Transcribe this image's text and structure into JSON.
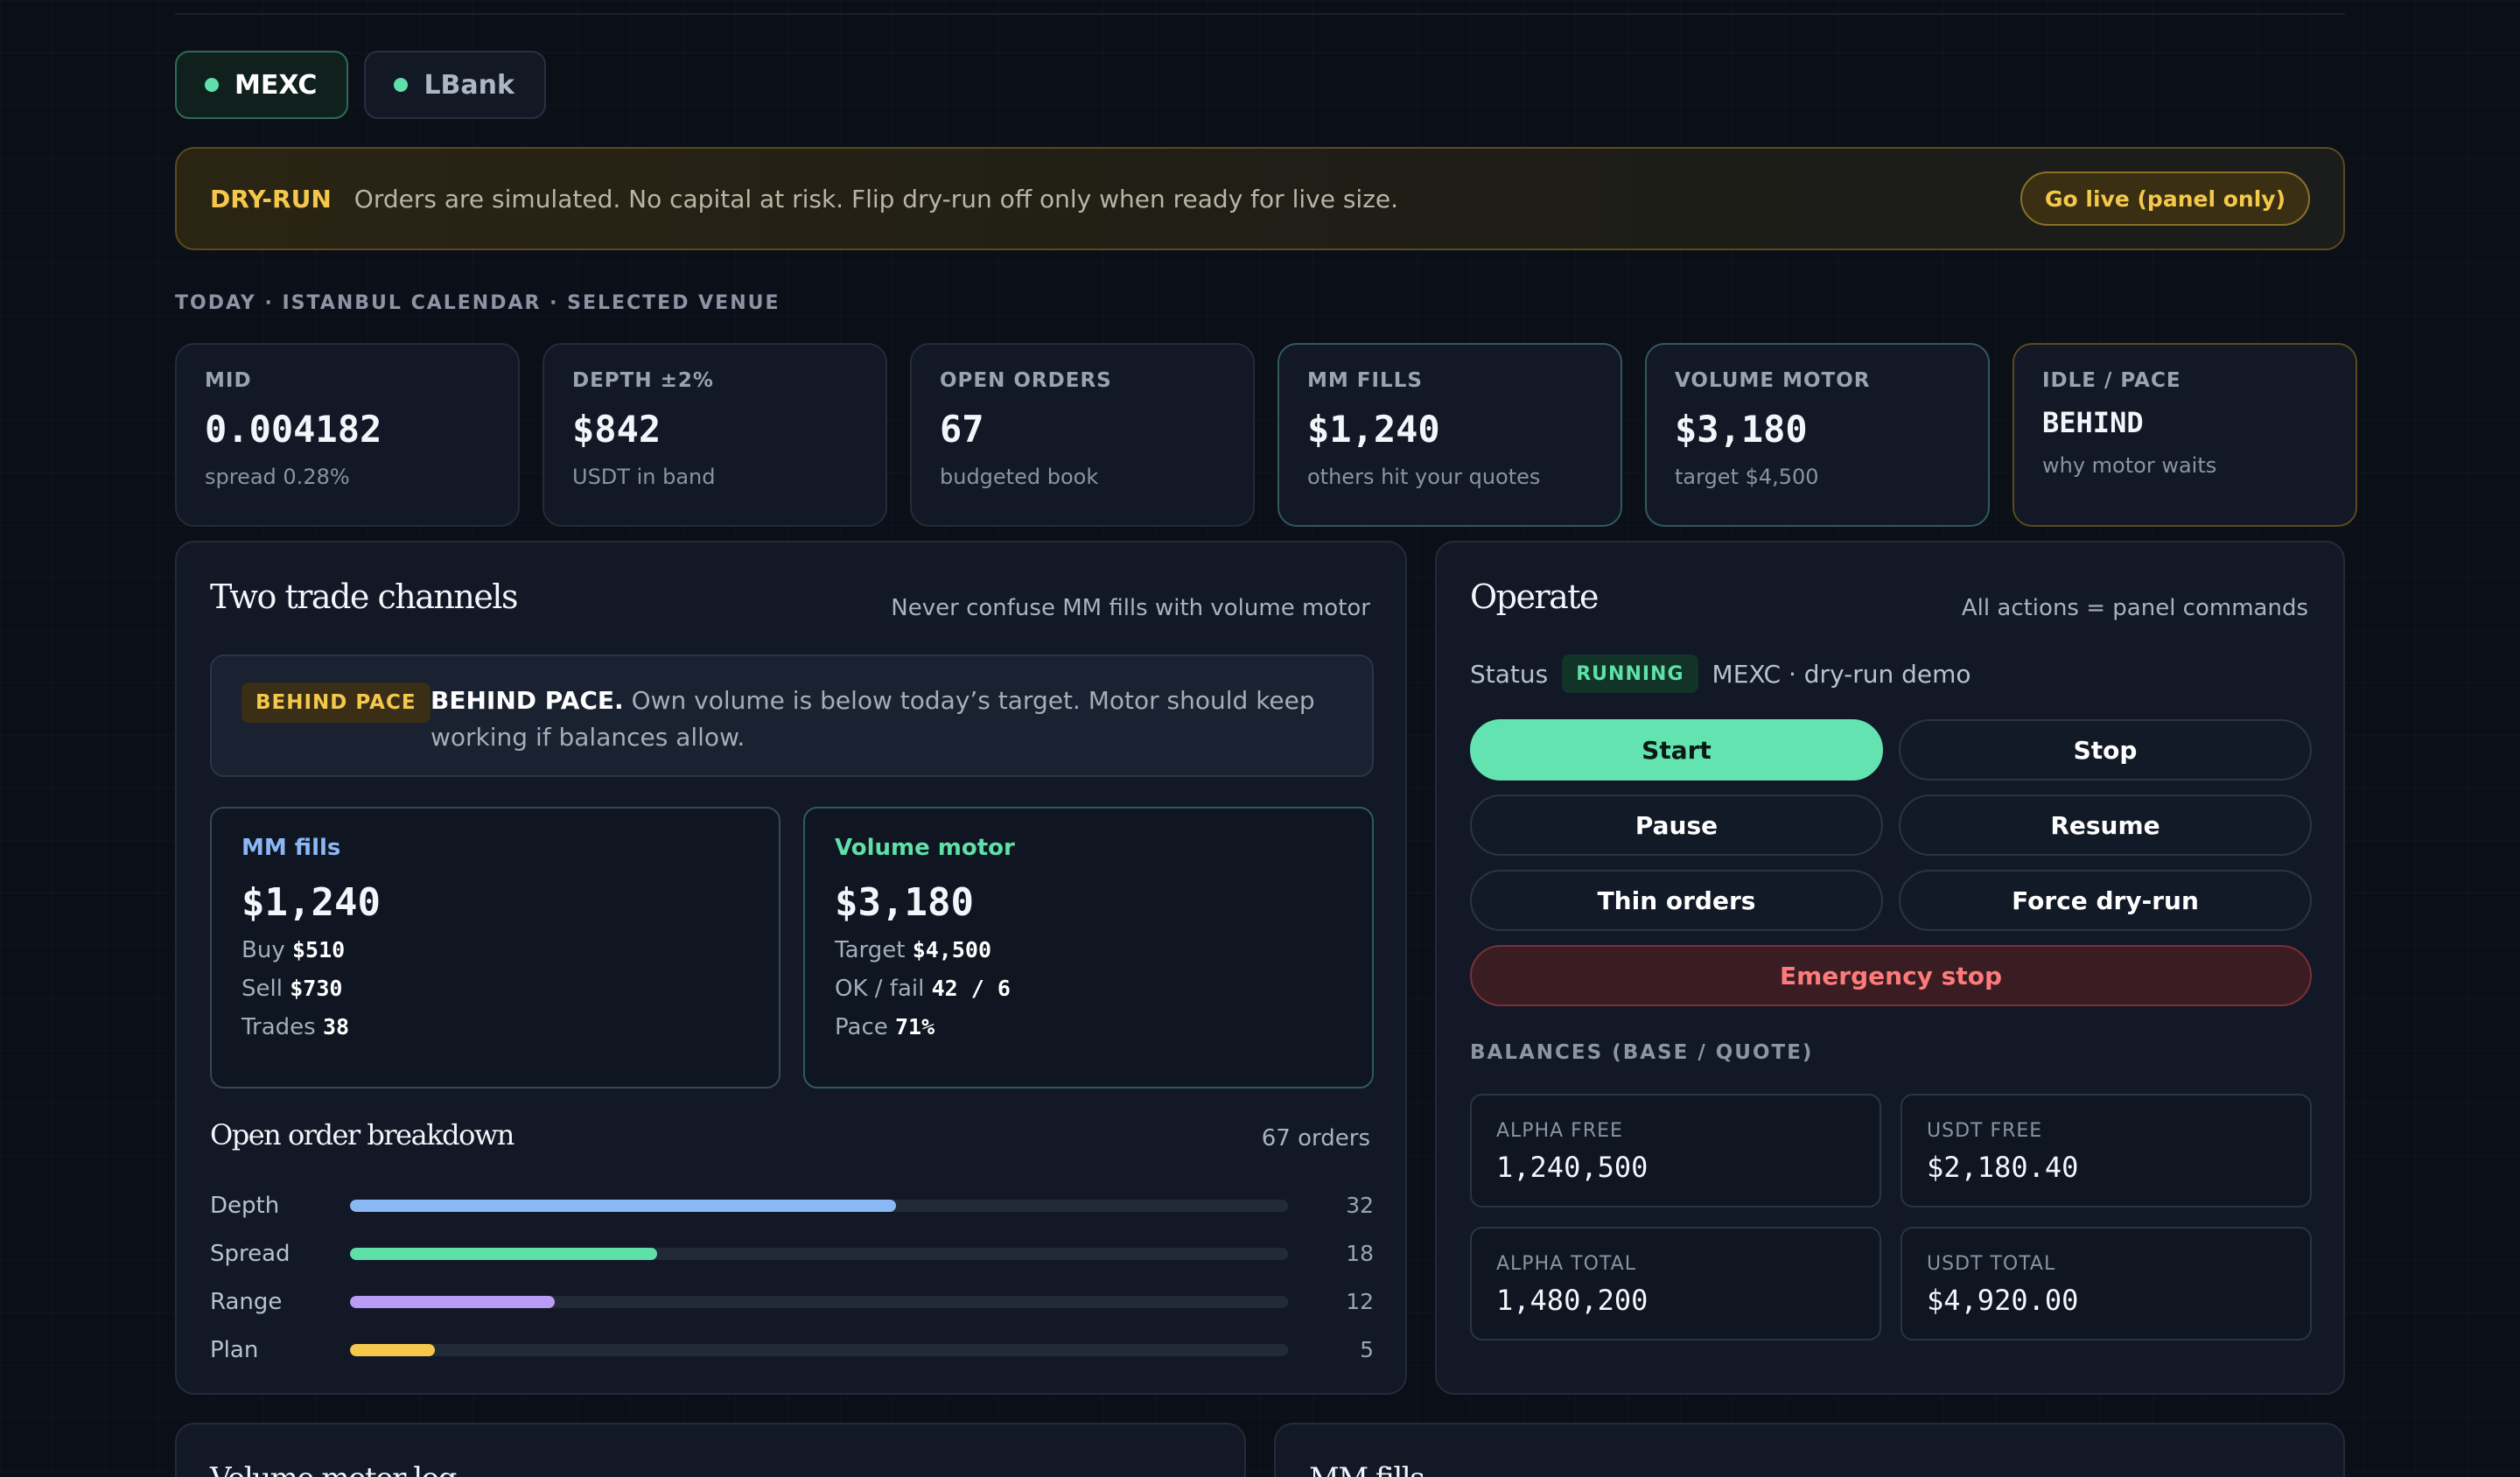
{
  "venues": [
    {
      "label": "MEXC",
      "active": true
    },
    {
      "label": "LBank",
      "active": false
    }
  ],
  "banner": {
    "tag": "DRY-RUN",
    "message": "Orders are simulated. No capital at risk. Flip dry-run off only when ready for live size.",
    "button": "Go live (panel only)"
  },
  "section_label": "TODAY · ISTANBUL CALENDAR · SELECTED VENUE",
  "stats": [
    {
      "label": "MID",
      "value": "0.004182",
      "sub": "spread 0.28%"
    },
    {
      "label": "DEPTH ±2%",
      "value": "$842",
      "sub": "USDT in band"
    },
    {
      "label": "OPEN ORDERS",
      "value": "67",
      "sub": "budgeted book"
    },
    {
      "label": "MM FILLS",
      "value": "$1,240",
      "sub": "others hit your quotes"
    },
    {
      "label": "VOLUME MOTOR",
      "value": "$3,180",
      "sub": "target $4,500"
    },
    {
      "label": "IDLE / PACE",
      "value": "BEHIND",
      "sub": "why motor waits"
    }
  ],
  "channels": {
    "title": "Two trade channels",
    "note": "Never confuse MM fills with volume motor",
    "pace_pill": "BEHIND PACE",
    "pace_bold": "BEHIND PACE.",
    "pace_text": " Own volume is below today’s target. Motor should keep working if balances allow.",
    "mm": {
      "heading": "MM fills",
      "value": "$1,240",
      "rows": [
        {
          "label": "Buy",
          "value": "$510"
        },
        {
          "label": "Sell",
          "value": "$730"
        },
        {
          "label": "Trades",
          "value": "38"
        }
      ]
    },
    "vm": {
      "heading": "Volume motor",
      "value": "$3,180",
      "rows": [
        {
          "label": "Target",
          "value": "$4,500"
        },
        {
          "label": "OK / fail",
          "value": "42 / 6"
        },
        {
          "label": "Pace",
          "value": "71%"
        }
      ]
    }
  },
  "breakdown": {
    "title": "Open order breakdown",
    "note": "67 orders",
    "max": 55,
    "items": [
      {
        "label": "Depth",
        "count": "32",
        "value": 32,
        "color": "#8ab8f5"
      },
      {
        "label": "Spread",
        "count": "18",
        "value": 18,
        "color": "#5fe0a8"
      },
      {
        "label": "Range",
        "count": "12",
        "value": 12,
        "color": "#b89cf5"
      },
      {
        "label": "Plan",
        "count": "5",
        "value": 5,
        "color": "#f4c84a"
      }
    ]
  },
  "operate": {
    "title": "Operate",
    "note": "All actions = panel commands",
    "status_label": "Status",
    "status_badge": "RUNNING",
    "status_text": "MEXC · dry-run demo",
    "buttons": {
      "start": "Start",
      "stop": "Stop",
      "pause": "Pause",
      "resume": "Resume",
      "thin": "Thin orders",
      "force": "Force dry-run",
      "emergency": "Emergency stop"
    },
    "balances_label": "BALANCES (BASE / QUOTE)",
    "balances": [
      {
        "label": "ALPHA FREE",
        "value": "1,240,500"
      },
      {
        "label": "USDT FREE",
        "value": "$2,180.40"
      },
      {
        "label": "ALPHA TOTAL",
        "value": "1,480,200"
      },
      {
        "label": "USDT TOTAL",
        "value": "$4,920.00"
      }
    ]
  },
  "lower": {
    "left_title": "Volume motor log",
    "right_title": "MM fills"
  }
}
